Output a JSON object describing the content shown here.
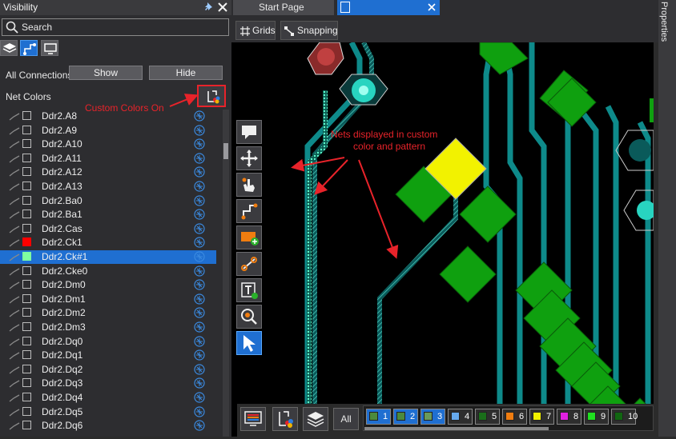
{
  "visibility_panel": {
    "title": "Visibility",
    "search_placeholder": "Search",
    "all_connections_label": "All Connections",
    "show_label": "Show",
    "hide_label": "Hide",
    "net_colors_label": "Net Colors",
    "nets": [
      {
        "name": "Ddr2.A8",
        "color": "none"
      },
      {
        "name": "Ddr2.A9",
        "color": "none"
      },
      {
        "name": "Ddr2.A10",
        "color": "none"
      },
      {
        "name": "Ddr2.A11",
        "color": "none"
      },
      {
        "name": "Ddr2.A12",
        "color": "none"
      },
      {
        "name": "Ddr2.A13",
        "color": "none"
      },
      {
        "name": "Ddr2.Ba0",
        "color": "none"
      },
      {
        "name": "Ddr2.Ba1",
        "color": "none"
      },
      {
        "name": "Ddr2.Cas",
        "color": "none"
      },
      {
        "name": "Ddr2.Ck1",
        "color": "#ff0000"
      },
      {
        "name": "Ddr2.Ck#1",
        "color": "#7fffa0",
        "selected": true
      },
      {
        "name": "Ddr2.Cke0",
        "color": "none"
      },
      {
        "name": "Ddr2.Dm0",
        "color": "none"
      },
      {
        "name": "Ddr2.Dm1",
        "color": "none"
      },
      {
        "name": "Ddr2.Dm2",
        "color": "none"
      },
      {
        "name": "Ddr2.Dm3",
        "color": "none"
      },
      {
        "name": "Ddr2.Dq0",
        "color": "none"
      },
      {
        "name": "Ddr2.Dq1",
        "color": "none"
      },
      {
        "name": "Ddr2.Dq2",
        "color": "none"
      },
      {
        "name": "Ddr2.Dq3",
        "color": "none"
      },
      {
        "name": "Ddr2.Dq4",
        "color": "none"
      },
      {
        "name": "Ddr2.Dq5",
        "color": "none"
      },
      {
        "name": "Ddr2.Dq6",
        "color": "none"
      }
    ]
  },
  "tabs": {
    "start_page": "Start Page",
    "active_tab": ""
  },
  "toolbar": {
    "grids_label": "Grids",
    "snapping_label": "Snapping"
  },
  "properties_label": "Properties",
  "annotations": {
    "custom_colors_on": "Custom Colors On",
    "nets_displayed_line1": "Nets displayed in custom",
    "nets_displayed_line2": "color and pattern"
  },
  "layers_bar": {
    "all_label": "All",
    "layers": [
      {
        "num": "1",
        "color": "#4c8a3c",
        "active": true
      },
      {
        "num": "2",
        "color": "#4c8a3c",
        "active": true
      },
      {
        "num": "3",
        "color": "#6a9a5a",
        "active": true
      },
      {
        "num": "4",
        "color": "#66aaee",
        "active": false
      },
      {
        "num": "5",
        "color": "#1a6e1a",
        "active": false
      },
      {
        "num": "6",
        "color": "#f07d10",
        "active": false
      },
      {
        "num": "7",
        "color": "#f0f000",
        "active": false
      },
      {
        "num": "8",
        "color": "#e020e0",
        "active": false
      },
      {
        "num": "9",
        "color": "#20e020",
        "active": false
      },
      {
        "num": "10",
        "color": "#116611",
        "active": false
      }
    ]
  },
  "colors": {
    "accent": "#1f6fd1",
    "trace": "#0e8a8a",
    "pad": "#0fa00f",
    "highlight_pad": "#f2f200"
  }
}
